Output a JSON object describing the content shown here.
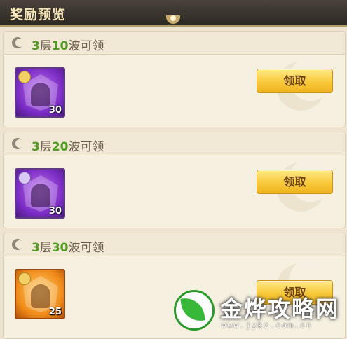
{
  "header": {
    "title": "奖励预览"
  },
  "rewards": [
    {
      "prefix": "3",
      "floor_label": "层",
      "waves": "10",
      "suffix": "波可领",
      "quantity": "30",
      "claim_label": "领取",
      "box_color": "purple"
    },
    {
      "prefix": "3",
      "floor_label": "层",
      "waves": "20",
      "suffix": "波可领",
      "quantity": "30",
      "claim_label": "领取",
      "box_color": "purple"
    },
    {
      "prefix": "3",
      "floor_label": "层",
      "waves": "30",
      "suffix": "波可领",
      "quantity": "25",
      "claim_label": "领取",
      "box_color": "orange"
    }
  ],
  "watermark": {
    "brand": "金烨攻略网",
    "url": "www.jykz.com.cn"
  },
  "colors": {
    "accent_green": "#4f9d1e",
    "button_gold": "#f8c93a",
    "header_bg": "#2d2823"
  }
}
